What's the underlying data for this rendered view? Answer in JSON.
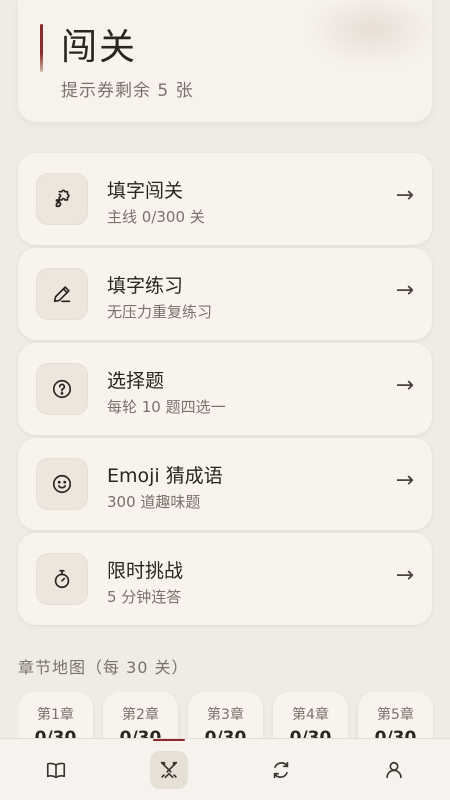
{
  "header": {
    "title": "闯关",
    "subtitle": "提示券剩余 5 张"
  },
  "modes": [
    {
      "title": "填字闯关",
      "desc": "主线 0/300 关",
      "icon": "puzzle-icon",
      "arrow": "→"
    },
    {
      "title": "填字练习",
      "desc": "无压力重复练习",
      "icon": "pencil-icon",
      "arrow": "→"
    },
    {
      "title": "选择题",
      "desc": "每轮 10 题四选一",
      "icon": "question-circle-icon",
      "arrow": "→"
    },
    {
      "title": "Emoji 猜成语",
      "desc": "300 道趣味题",
      "icon": "smiley-icon",
      "arrow": "→"
    },
    {
      "title": "限时挑战",
      "desc": "5 分钟连答",
      "icon": "stopwatch-icon",
      "arrow": "→"
    }
  ],
  "chapters": {
    "heading": "章节地图（每 30 关）",
    "items": [
      {
        "name": "第1章",
        "progress": "0/30"
      },
      {
        "name": "第2章",
        "progress": "0/30"
      },
      {
        "name": "第3章",
        "progress": "0/30"
      },
      {
        "name": "第4章",
        "progress": "0/30"
      },
      {
        "name": "第5章",
        "progress": "0/30"
      }
    ]
  },
  "nav": {
    "items": [
      {
        "icon": "book-icon",
        "active": false
      },
      {
        "icon": "crossed-swords-icon",
        "active": true
      },
      {
        "icon": "refresh-icon",
        "active": false
      },
      {
        "icon": "user-icon",
        "active": false
      }
    ]
  },
  "colors": {
    "accent": "#8b2a2a",
    "background": "#efece5",
    "card": "#f8f4ed"
  }
}
